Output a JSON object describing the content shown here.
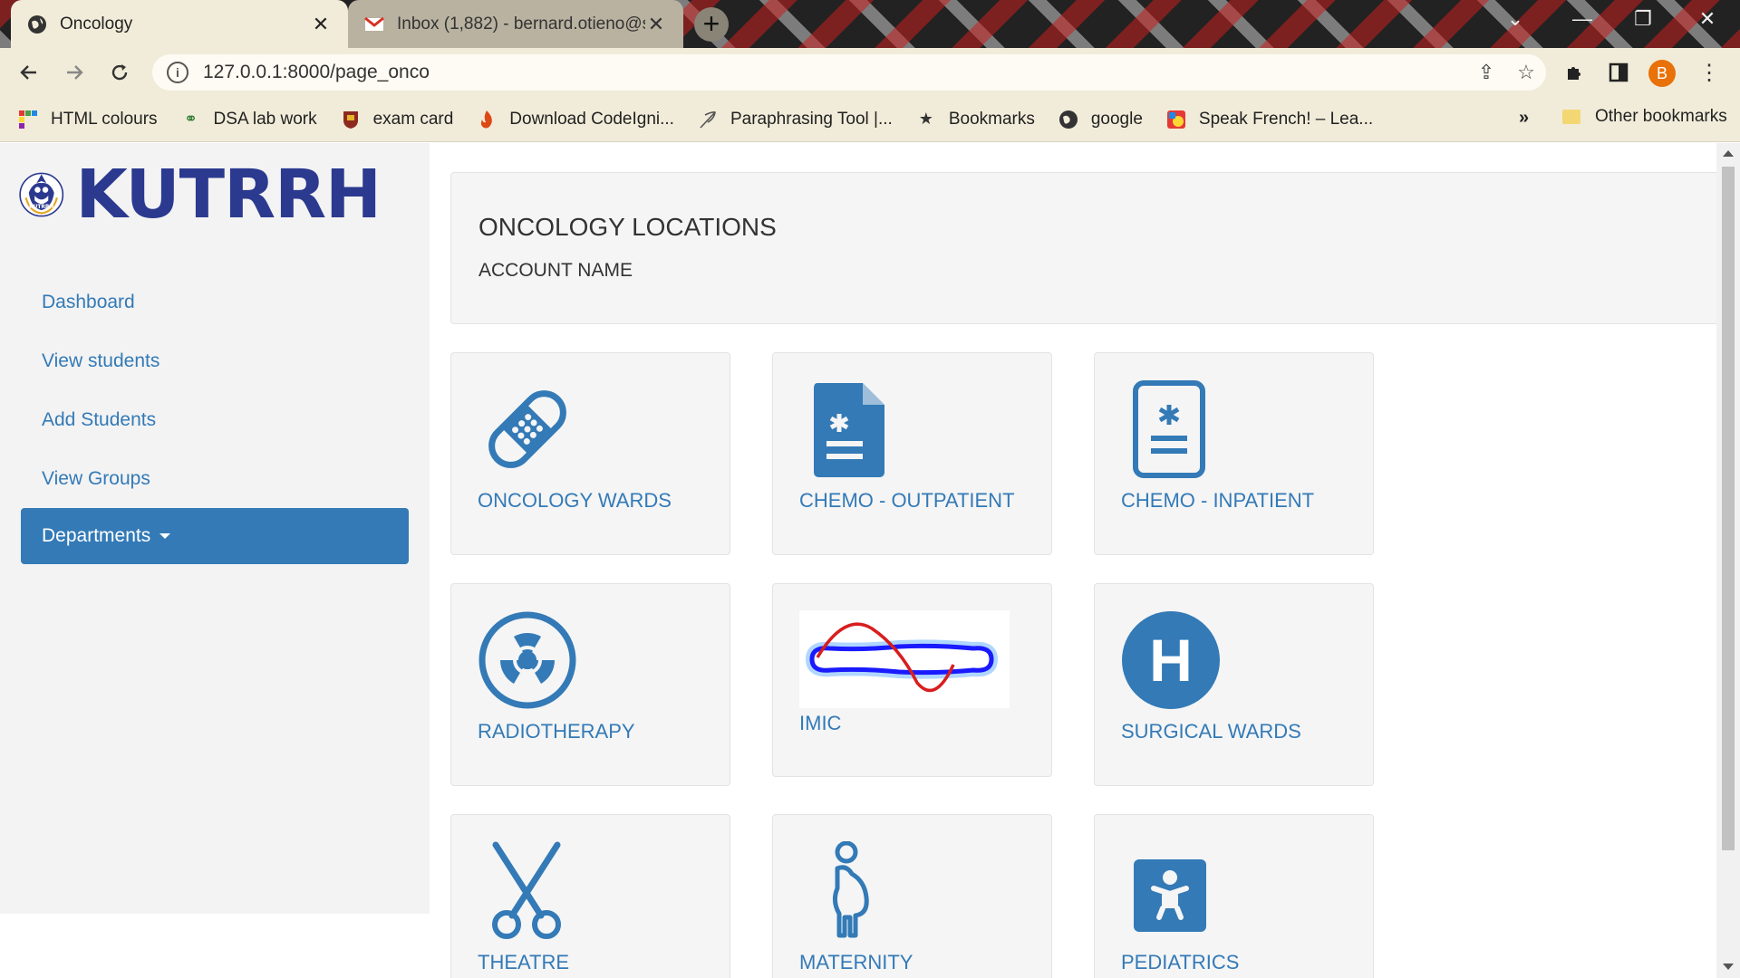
{
  "browser": {
    "tabs": [
      {
        "title": "Oncology",
        "active": true
      },
      {
        "title": "Inbox (1,882) - bernard.otieno@s",
        "active": false
      }
    ],
    "url": "127.0.0.1:8000/page_onco",
    "profile_initial": "B",
    "bookmarks": [
      {
        "label": "HTML colours",
        "icon": "grid-icon"
      },
      {
        "label": "DSA lab work",
        "icon": "link-icon"
      },
      {
        "label": "exam card",
        "icon": "crest-icon"
      },
      {
        "label": "Download CodeIgni...",
        "icon": "flame-icon"
      },
      {
        "label": "Paraphrasing Tool |...",
        "icon": "feather-icon"
      },
      {
        "label": "Bookmarks",
        "icon": "star-icon"
      },
      {
        "label": "google",
        "icon": "globe-icon"
      },
      {
        "label": "Speak French! – Lea...",
        "icon": "flag-icon"
      }
    ],
    "more_bookmarks": "»",
    "other_bookmarks": "Other bookmarks"
  },
  "brand": {
    "logo_text": "KUTRRH"
  },
  "sidebar": {
    "items": [
      {
        "label": "Dashboard"
      },
      {
        "label": "View students"
      },
      {
        "label": "Add Students"
      },
      {
        "label": "View Groups"
      },
      {
        "label": "Departments"
      }
    ]
  },
  "header": {
    "title": "ONCOLOGY LOCATIONS",
    "subtitle": "ACCOUNT NAME"
  },
  "cards": [
    {
      "label": "ONCOLOGY WARDS",
      "icon": "bandage-icon"
    },
    {
      "label": "CHEMO - OUTPATIENT",
      "icon": "medical-file-icon"
    },
    {
      "label": "CHEMO - INPATIENT",
      "icon": "medical-clipboard-icon"
    },
    {
      "label": "RADIOTHERAPY",
      "icon": "radiation-icon"
    },
    {
      "label": "IMIC",
      "icon": "body-scan-image"
    },
    {
      "label": "SURGICAL WARDS",
      "icon": "hospital-icon"
    },
    {
      "label": "THEATRE",
      "icon": "scissors-icon"
    },
    {
      "label": "MATERNITY",
      "icon": "pregnant-woman-icon"
    },
    {
      "label": "PEDIATRICS",
      "icon": "baby-icon"
    }
  ],
  "colors": {
    "primary": "#337ab7",
    "brand": "#2b3a8f",
    "chrome": "#f1ecd9"
  }
}
